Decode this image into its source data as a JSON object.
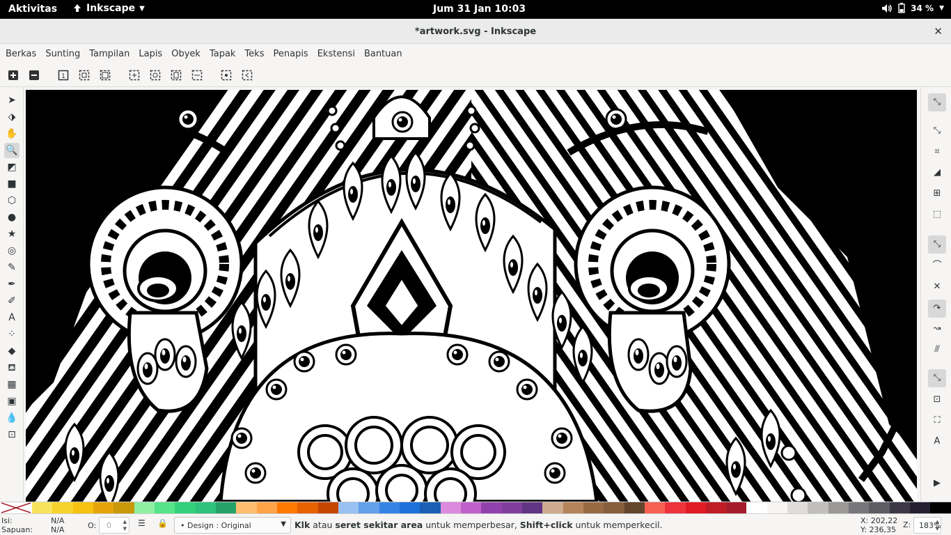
{
  "topbar": {
    "activities": "Aktivitas",
    "app_name": "Inkscape",
    "clock": "Jum 31 Jan  10:03",
    "battery": "34 %",
    "icons": [
      "inkscape-icon",
      "volume-icon",
      "battery-icon",
      "power-menu-icon"
    ]
  },
  "window": {
    "title": "*artwork.svg - Inkscape",
    "close_label": "✕"
  },
  "menu": {
    "items": [
      "Berkas",
      "Sunting",
      "Tampilan",
      "Lapis",
      "Obyek",
      "Tapak",
      "Teks",
      "Penapis",
      "Ekstensi",
      "Bantuan"
    ]
  },
  "commands": {
    "icons": [
      "zoom-in-icon",
      "zoom-out-icon",
      "zoom-1-1-icon",
      "zoom-1-2-icon",
      "zoom-2-1-icon",
      "zoom-selection-icon",
      "zoom-drawing-icon",
      "zoom-page-icon",
      "zoom-page-width-icon",
      "zoom-center-page-icon",
      "zoom-prev-icon"
    ]
  },
  "tools": {
    "icons": [
      "selector-icon",
      "node-icon",
      "tweak-icon",
      "zoom-icon",
      "measure-icon",
      "rect-icon",
      "box3d-icon",
      "ellipse-icon",
      "star-icon",
      "spiral-icon",
      "pencil-icon",
      "pen-icon",
      "calligraphy-icon",
      "text-icon",
      "spray-icon",
      "eraser-icon",
      "bucket-icon",
      "gradient-icon",
      "mesh-icon",
      "dropper-icon",
      "connector-icon"
    ],
    "active": "zoom-icon"
  },
  "snap": {
    "icons": [
      "snap-enable-icon",
      "snap-bbox-icon",
      "snap-bbox-edge-icon",
      "snap-bbox-corner-icon",
      "snap-bbox-midpoint-icon",
      "snap-bbox-center-icon",
      "snap-nodes-icon",
      "snap-path-icon",
      "snap-intersection-icon",
      "snap-cusp-icon",
      "snap-smooth-icon",
      "snap-line-midpoint-icon",
      "snap-others-icon",
      "snap-object-center-icon",
      "snap-rotation-center-icon",
      "snap-text-baseline-icon",
      "snap-page-border-icon",
      "snap-grid-icon",
      "more-arrow-icon"
    ]
  },
  "palette": {
    "colors": [
      "#f8e45c",
      "#f6d32d",
      "#f5c211",
      "#e5a50a",
      "#c89909",
      "#8ff0a4",
      "#57e389",
      "#33d17a",
      "#2ec27e",
      "#26a269",
      "#ffbe6f",
      "#ffa348",
      "#ff7800",
      "#e66100",
      "#c64600",
      "#99c1f1",
      "#62a0ea",
      "#3584e4",
      "#1c71d8",
      "#1a5fb4",
      "#dc8add",
      "#c061cb",
      "#9141ac",
      "#813d9c",
      "#613583",
      "#cdab8f",
      "#b5835a",
      "#986a44",
      "#865e3c",
      "#63452c",
      "#f66151",
      "#ed333b",
      "#e01b24",
      "#c01c28",
      "#a51d2d",
      "#ffffff",
      "#f6f5f4",
      "#deddda",
      "#c0bfbc",
      "#9a9996",
      "#77767b",
      "#5e5c64",
      "#3d3846",
      "#241f31",
      "#000000"
    ]
  },
  "status": {
    "fill_label": "Isi:",
    "fill_value": "N/A",
    "stroke_label": "Sapuan:",
    "stroke_value": "N/A",
    "opacity_label": "O:",
    "opacity_value": "0",
    "layer": "• Design : Original",
    "message_pre": "Klk",
    "message_1": " atau ",
    "message_b2": "seret sekitar area",
    "message_2": " untuk memperbesar, ",
    "message_b3": "Shift+click",
    "message_3": " untuk memperkecil.",
    "x_label": "X:",
    "x_value": "202,22",
    "y_label": "Y:",
    "y_value": "236,35",
    "zoom_label": "Z:",
    "zoom_value": "183%"
  }
}
